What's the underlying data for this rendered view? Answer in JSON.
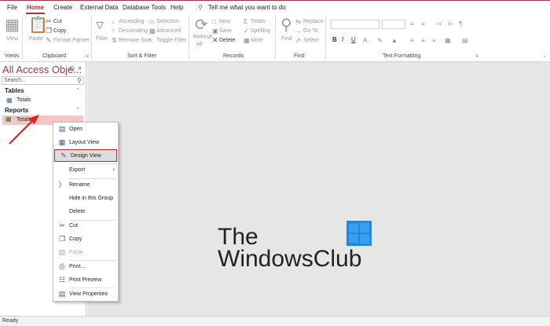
{
  "menu": {
    "tabs": [
      "File",
      "Home",
      "Create",
      "External Data",
      "Database Tools",
      "Help"
    ],
    "tell_me": "Tell me what you want to do"
  },
  "ribbon": {
    "views": {
      "view_label": "View",
      "group": "Views"
    },
    "clipboard": {
      "paste": "Paste",
      "cut": "Cut",
      "copy": "Copy",
      "format_painter": "Format Painter",
      "group": "Clipboard"
    },
    "sort_filter": {
      "filter": "Filter",
      "ascending": "Ascending",
      "descending": "Descending",
      "remove_sort": "Remove Sort",
      "selection": "Selection",
      "advanced": "Advanced",
      "toggle_filter": "Toggle Filter",
      "group": "Sort & Filter"
    },
    "records": {
      "refresh": "Refresh",
      "all": "All",
      "new": "New",
      "save": "Save",
      "delete": "Delete",
      "totals": "Totals",
      "spelling": "Spelling",
      "more": "More",
      "group": "Records"
    },
    "find": {
      "find": "Find",
      "replace": "Replace",
      "go_to": "Go To",
      "select": "Select",
      "group": "Find"
    },
    "text_formatting": {
      "bold": "B",
      "italic": "I",
      "underline": "U",
      "group": "Text Formatting"
    }
  },
  "nav": {
    "title": "All Access Obje...",
    "search_placeholder": "Search...",
    "sections": [
      {
        "name": "Tables",
        "items": [
          "Totals"
        ]
      },
      {
        "name": "Reports",
        "items": [
          "Totals"
        ]
      }
    ]
  },
  "context_menu": {
    "items": [
      "Open",
      "Layout View",
      "Design View",
      "Export",
      "Rename",
      "Hide in this Group",
      "Delete",
      "Cut",
      "Copy",
      "Paste",
      "Print...",
      "Print Preview",
      "View Properties"
    ],
    "highlighted": "Design View"
  },
  "watermark": {
    "line1": "The",
    "line2": "WindowsClub"
  },
  "status": {
    "text": "Ready"
  },
  "colors": {
    "accent": "#a4373a",
    "highlight_border": "#c0272d",
    "arrow": "#e02020"
  }
}
